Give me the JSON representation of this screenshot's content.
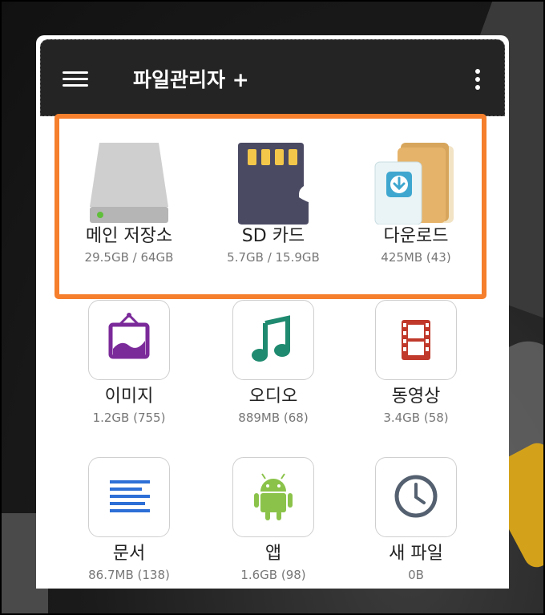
{
  "header": {
    "title": "파일관리자 +"
  },
  "storage": [
    {
      "label": "메인 저장소",
      "size": "29.5GB / 64GB",
      "icon": "hard-drive-icon"
    },
    {
      "label": "SD 카드",
      "size": "5.7GB / 15.9GB",
      "icon": "sd-card-icon"
    },
    {
      "label": "다운로드",
      "size": "425MB (43)",
      "icon": "download-folder-icon"
    }
  ],
  "categories": [
    {
      "label": "이미지",
      "size": "1.2GB (755)",
      "icon": "image-icon",
      "color": "#7b2a9a"
    },
    {
      "label": "오디오",
      "size": "889MB (68)",
      "icon": "music-note-icon",
      "color": "#1f8a6f"
    },
    {
      "label": "동영상",
      "size": "3.4GB (58)",
      "icon": "film-icon",
      "color": "#c0392b"
    },
    {
      "label": "문서",
      "size": "86.7MB (138)",
      "icon": "document-lines-icon",
      "color": "#2d6fd6"
    },
    {
      "label": "앱",
      "size": "1.6GB (98)",
      "icon": "android-icon",
      "color": "#8bc34a"
    },
    {
      "label": "새 파일",
      "size": "0B",
      "icon": "clock-icon",
      "color": "#54606f"
    }
  ],
  "colors": {
    "accent_outline": "#f57f2c",
    "appbar": "#242424"
  }
}
